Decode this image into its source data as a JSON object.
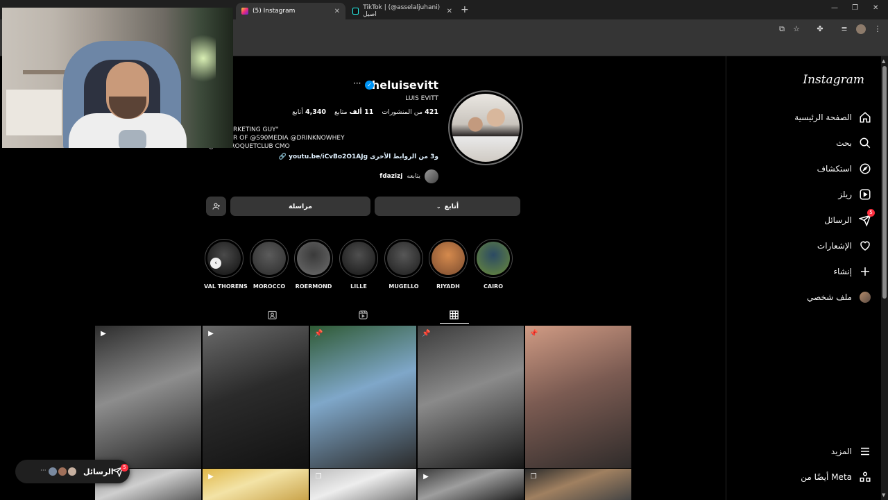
{
  "browser": {
    "tabs": [
      {
        "title": "(5) Instagram",
        "active": true
      },
      {
        "title": "TikTok | (@asselaljuhani) اصيل",
        "active": false
      }
    ],
    "new_tab": "+",
    "window_controls": {
      "minimize": "—",
      "restore": "❐",
      "close": "✕"
    }
  },
  "sidebar": {
    "logo": "Instagram",
    "items": [
      {
        "label": "الصفحة الرئيسية",
        "icon": "home-icon"
      },
      {
        "label": "بحث",
        "icon": "search-icon"
      },
      {
        "label": "استكشاف",
        "icon": "explore-icon"
      },
      {
        "label": "ريلز",
        "icon": "reels-icon"
      },
      {
        "label": "الرسائل",
        "icon": "messages-icon",
        "badge": "5"
      },
      {
        "label": "الإشعارات",
        "icon": "heart-icon"
      },
      {
        "label": "إنشاء",
        "icon": "plus-icon"
      },
      {
        "label": "ملف شخصي",
        "icon": "avatar-icon"
      }
    ],
    "bottom_items": [
      {
        "label": "المزيد",
        "icon": "menu-icon"
      },
      {
        "label": "أيضًا من Meta",
        "icon": "meta-apps-icon"
      }
    ]
  },
  "profile": {
    "username": "theluisevitt",
    "more": "···",
    "full_name": "LUIS EVITT",
    "stats": {
      "posts_count": "421",
      "posts_label": "من المنشورات",
      "followers_count": "11 ألف",
      "followers_label": "متابع",
      "following_count": "4,340",
      "following_label": "أتابع"
    },
    "bio": [
      "RKETING GUY\"",
      "R OF @S90MEDIA @DRINKNOWHEY",
      "@ ...ECROQUETCLUB CMO"
    ],
    "link": "youtu.be/iCvBo2O1AJg و3 من الروابط الأخرى",
    "followed_by_label": "يتابعه",
    "followed_by_user": "fdazizj",
    "buttons": {
      "follow": "أتابع",
      "message": "مراسلة"
    }
  },
  "highlights": [
    {
      "label": "CAIRO",
      "colors": [
        "#2b4a63",
        "#6b8b3a"
      ]
    },
    {
      "label": "RIYADH",
      "colors": [
        "#d58a4d",
        "#7a4b2f"
      ]
    },
    {
      "label": "MUGELLO",
      "colors": [
        "#575757",
        "#1c1c1c"
      ]
    },
    {
      "label": "LILLE",
      "colors": [
        "#4f4f4f",
        "#151515"
      ]
    },
    {
      "label": "ROERMOND",
      "colors": [
        "#3a3a3a",
        "#6d6d6d"
      ]
    },
    {
      "label": "MOROCCO",
      "colors": [
        "#5b5b5b",
        "#2b2b2b"
      ]
    },
    {
      "label": "VAL THORENS",
      "colors": [
        "#4a4a4a",
        "#0f0f0f"
      ]
    }
  ],
  "grid": [
    {
      "type": "reel",
      "colors": [
        "#2d2d2d",
        "#8d8d8d",
        "#1f1f1f"
      ]
    },
    {
      "type": "reel",
      "colors": [
        "#6a6a6a",
        "#2b2b2b",
        "#111111"
      ]
    },
    {
      "type": "pinned",
      "colors": [
        "#2f5a34",
        "#7fa7c9",
        "#2a2a2a"
      ]
    },
    {
      "type": "pinned",
      "colors": [
        "#3b3b3b",
        "#8a8a8a",
        "#171717"
      ]
    },
    {
      "type": "pinned",
      "colors": [
        "#d09b84",
        "#7b5b52",
        "#2f2b2a"
      ]
    },
    {
      "type": "none",
      "colors": [
        "#8a8a8a",
        "#cfcfcf",
        "#5a5a5a"
      ]
    },
    {
      "type": "reel",
      "colors": [
        "#e0b84a",
        "#f3e3a6",
        "#c9a34a"
      ]
    },
    {
      "type": "carousel",
      "colors": [
        "#bdbdbd",
        "#ededed",
        "#777777"
      ]
    },
    {
      "type": "reel",
      "colors": [
        "#3a3a3a",
        "#9e9e9e",
        "#1e1e1e"
      ]
    },
    {
      "type": "carousel",
      "colors": [
        "#2b2b2b",
        "#a08060",
        "#444444"
      ]
    }
  ],
  "messages_pill": {
    "label": "الرسائل",
    "badge": "5",
    "dots": "···"
  }
}
